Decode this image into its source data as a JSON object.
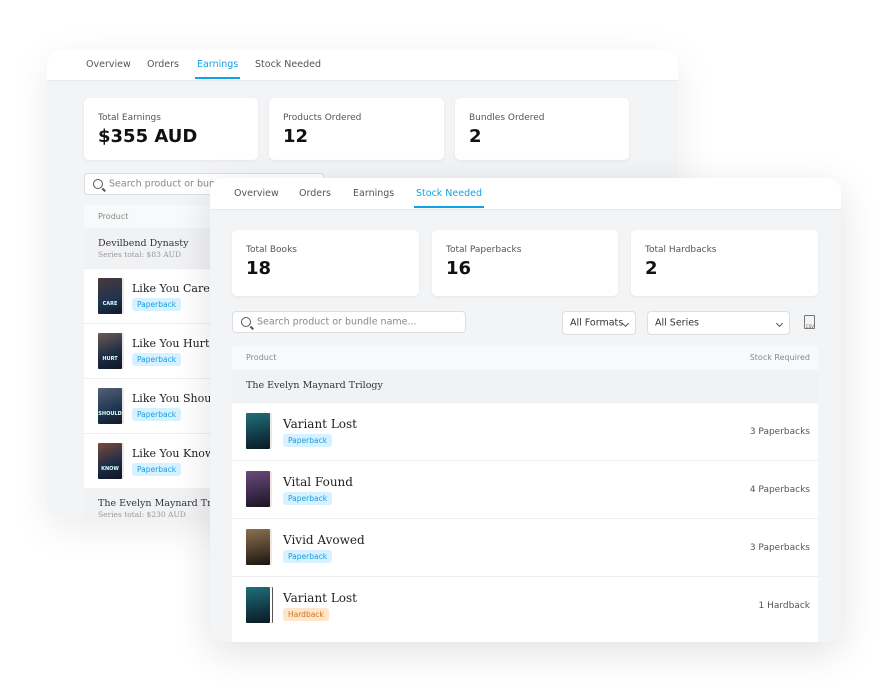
{
  "colors": {
    "accent": "#11a3e8",
    "paperback_bg": "#d6f1ff",
    "hardback_bg": "#ffe5c9"
  },
  "back": {
    "tabs": [
      "Overview",
      "Orders",
      "Earnings",
      "Stock Needed"
    ],
    "active_tab": "Earnings",
    "cards": [
      {
        "label": "Total Earnings",
        "value": "$355 AUD"
      },
      {
        "label": "Products Ordered",
        "value": "12"
      },
      {
        "label": "Bundles Ordered",
        "value": "2"
      }
    ],
    "search_placeholder": "Search product or bundle name...",
    "table_header": "Product",
    "groups": [
      {
        "name": "Devilbend Dynasty",
        "total": "Series total: $83 AUD"
      },
      {
        "name": "The Evelyn Maynard Trilogy",
        "total": "Series total: $230 AUD"
      }
    ],
    "items": [
      {
        "title": "Like You Care",
        "format": "Paperback",
        "cover_text": "CARE"
      },
      {
        "title": "Like You Hurt",
        "format": "Paperback",
        "cover_text": "HURT"
      },
      {
        "title": "Like You Should",
        "format": "Paperback",
        "cover_text": "SHOULD"
      },
      {
        "title": "Like You Know",
        "format": "Paperback",
        "cover_text": "KNOW"
      }
    ]
  },
  "front": {
    "tabs": [
      "Overview",
      "Orders",
      "Earnings",
      "Stock Needed"
    ],
    "active_tab": "Stock Needed",
    "cards": [
      {
        "label": "Total Books",
        "value": "18"
      },
      {
        "label": "Total Paperbacks",
        "value": "16"
      },
      {
        "label": "Total Hardbacks",
        "value": "2"
      }
    ],
    "search_placeholder": "Search product or bundle name...",
    "format_filter": "All Formats",
    "series_filter": "All Series",
    "csv_icon": "csv-file-icon",
    "csv_label": "CSV",
    "table_header": {
      "product": "Product",
      "stock": "Stock Required"
    },
    "group": "The Evelyn Maynard Trilogy",
    "items": [
      {
        "title": "Variant Lost",
        "format": "Paperback",
        "stock": "3 Paperbacks"
      },
      {
        "title": "Vital Found",
        "format": "Paperback",
        "stock": "4 Paperbacks"
      },
      {
        "title": "Vivid Avowed",
        "format": "Paperback",
        "stock": "3 Paperbacks"
      },
      {
        "title": "Variant Lost",
        "format": "Hardback",
        "stock": "1 Hardback"
      }
    ]
  }
}
